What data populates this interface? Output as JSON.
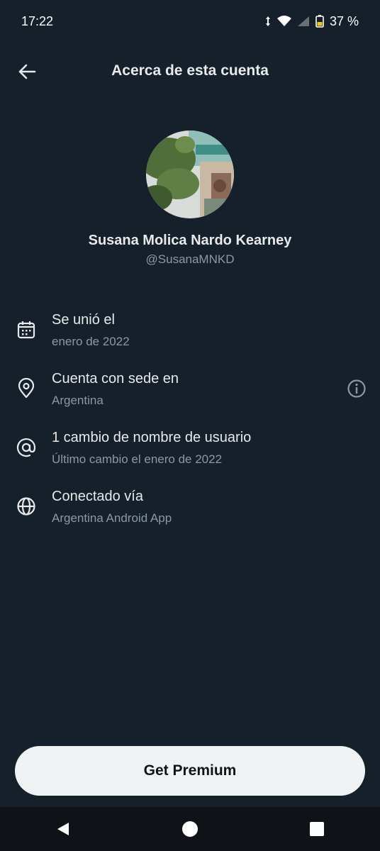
{
  "status": {
    "time": "17:22",
    "battery": "37 %"
  },
  "header": {
    "title": "Acerca de esta cuenta"
  },
  "profile": {
    "name": "Susana Molica Nardo Kearney",
    "handle": "@SusanaMNKD"
  },
  "rows": [
    {
      "icon": "calendar-icon",
      "label": "Se unió el",
      "value": "enero de 2022"
    },
    {
      "icon": "location-pin-icon",
      "label": "Cuenta con sede en",
      "value": "Argentina"
    },
    {
      "icon": "at-sign-icon",
      "label": "1 cambio de nombre de usuario",
      "value": "Último cambio el enero de 2022"
    },
    {
      "icon": "globe-icon",
      "label": "Conectado vía",
      "value": "Argentina Android App"
    }
  ],
  "premium_button": {
    "label": "Get Premium"
  },
  "colors": {
    "background": "#15202b",
    "text": "#e7e9ea",
    "secondary": "#8b98a5",
    "button_bg": "#eff3f4"
  }
}
